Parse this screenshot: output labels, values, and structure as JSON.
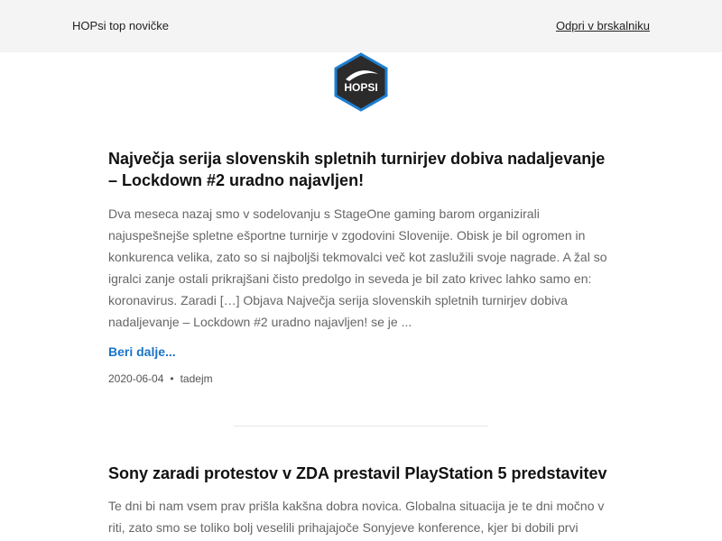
{
  "header": {
    "brand": "HOPsi top novičke",
    "open_in_browser": "Odpri v brskalniku"
  },
  "logo": {
    "text": "HOPSI",
    "bg_color": "#2b2b2b",
    "border_color": "#1e7fd1"
  },
  "articles": [
    {
      "title": "Največja serija slovenskih spletnih turnirjev dobiva nadaljevanje – Lockdown #2 uradno najavljen!",
      "excerpt": "Dva meseca nazaj smo v sodelovanju s StageOne gaming barom organizirali najuspešnejše spletne ešportne turnirje v zgodovini Slovenije. Obisk je bil ogromen in konkurenca velika, zato so si najboljši tekmovalci več kot zaslužili svoje nagrade. A žal so igralci zanje ostali prikrajšani čisto predolgo in seveda je bil zato krivec lahko samo en: koronavirus. Zaradi […] Objava Največja serija slovenskih spletnih turnirjev dobiva nadaljevanje – Lockdown #2 uradno najavljen! se je ...",
      "read_more": "Beri dalje...",
      "date": "2020-06-04",
      "separator": "•",
      "author": "tadejm"
    },
    {
      "title": "Sony zaradi protestov v ZDA prestavil PlayStation 5 predstavitev",
      "excerpt": "Te dni bi nam vsem prav prišla kakšna dobra novica. Globalna situacija je te dni močno v riti, zato smo se toliko bolj veselili prihajajoče Sonyjeve konference, kjer bi dobili prvi"
    }
  ],
  "colors": {
    "header_bg": "#f4f4f4",
    "link": "#1a73c8",
    "excerpt_text": "#666666"
  }
}
